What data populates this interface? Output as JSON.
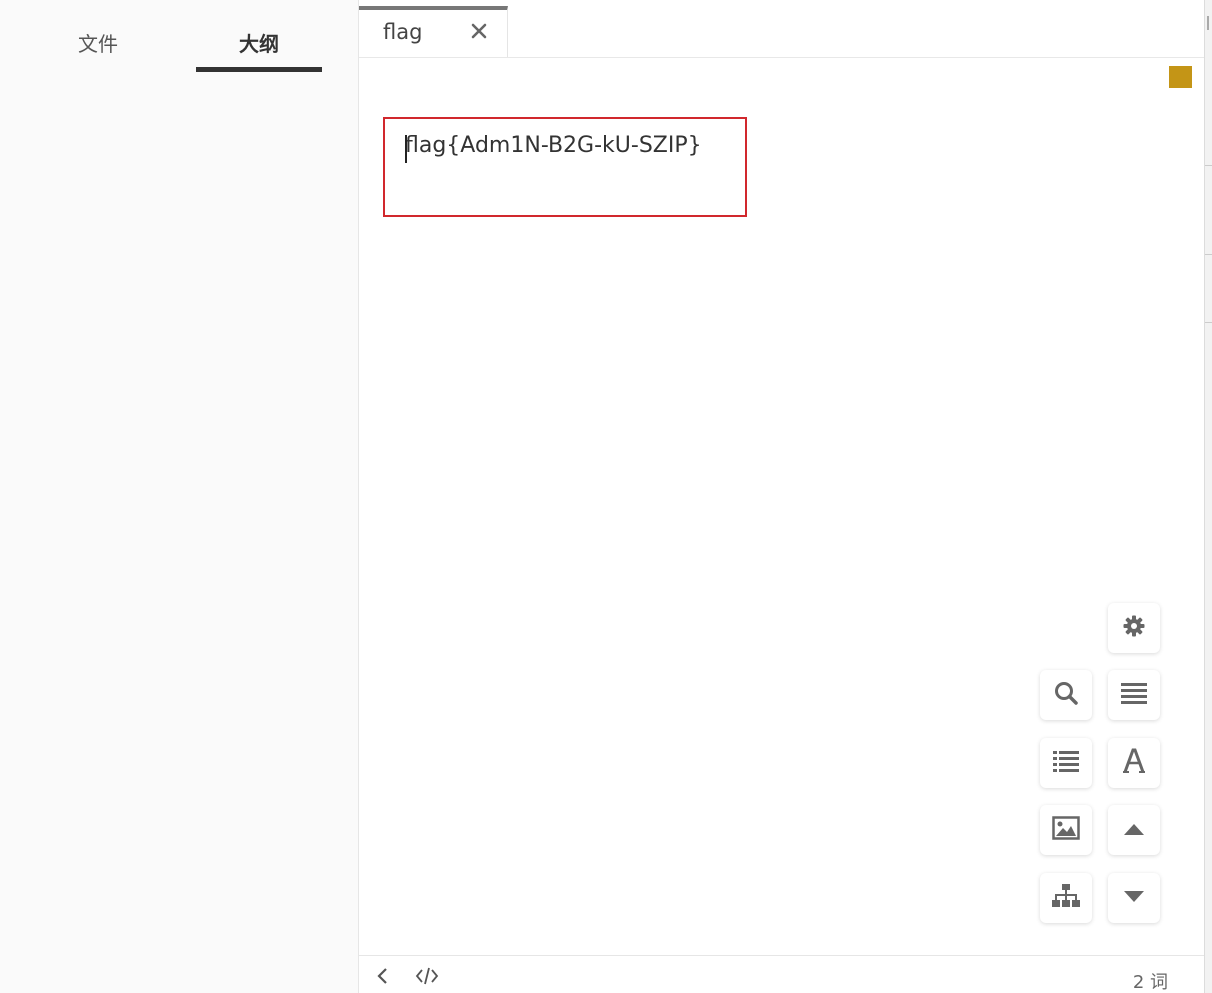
{
  "sidebar": {
    "tabs": [
      {
        "label": "文件"
      },
      {
        "label": "大纲",
        "active": true
      }
    ]
  },
  "editor": {
    "tab": {
      "title": "flag"
    },
    "content": "flag{Adm1N-B2G-kU-SZIP}",
    "highlight_color": "#d1282d",
    "marker_color": "#c49516"
  },
  "tools": [
    {
      "icon": "gear-icon"
    },
    {
      "icon": "search-icon"
    },
    {
      "icon": "paragraph-icon"
    },
    {
      "icon": "list-icon"
    },
    {
      "icon": "font-icon"
    },
    {
      "icon": "image-icon"
    },
    {
      "icon": "arrow-up-icon"
    },
    {
      "icon": "sitemap-icon"
    },
    {
      "icon": "arrow-down-icon"
    }
  ],
  "status": {
    "word_count": "2 词"
  }
}
